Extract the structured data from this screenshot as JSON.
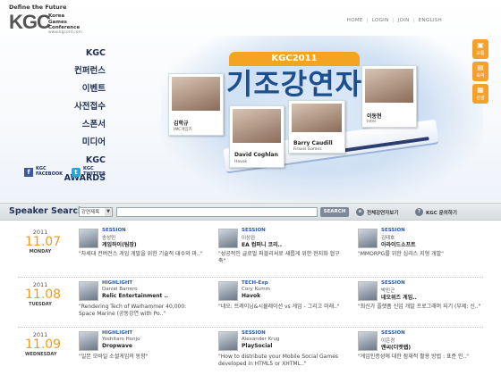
{
  "brand": {
    "tagline": "Define the Future",
    "logo_text": "KGC",
    "logo_lines": [
      "Korea",
      "Games",
      "Conference"
    ],
    "logo_url": "www.kgconf.com"
  },
  "topnav": [
    "HOME",
    "LOGIN",
    "JOIN",
    "ENGLISH"
  ],
  "menu": [
    "KGC",
    "컨퍼런스",
    "이벤트",
    "사전접수",
    "스폰서",
    "미디어",
    "KGC AWARDS"
  ],
  "social": [
    {
      "icon": "facebook-icon",
      "line1": "KGC",
      "line2": "FACEBOOK"
    },
    {
      "icon": "twitter-icon",
      "line1": "KGC",
      "line2": "TWITTER"
    }
  ],
  "quick": [
    {
      "icon": "car-icon",
      "label": "교통"
    },
    {
      "icon": "bed-icon",
      "label": "숙박"
    },
    {
      "icon": "map-icon",
      "label": "관광"
    }
  ],
  "banner": {
    "tab": "KGC2011",
    "title": "기조강연자"
  },
  "keynote": [
    {
      "name": "김학규",
      "org": "IMC게임즈"
    },
    {
      "name": "David Coghlan",
      "org": "Havok"
    },
    {
      "name": "Barry Caudill",
      "org": "Firaxis Games"
    },
    {
      "name": "이동현",
      "org": "Intel"
    }
  ],
  "search": {
    "title": "Speaker Search",
    "select_value": "강연제목",
    "input_value": "",
    "button": "SEARCH",
    "link1": "전체강연자보기",
    "link2": "KGC 문의하기"
  },
  "days": [
    {
      "year": "2011",
      "date": "11.07",
      "weekday": "MONDAY",
      "sessions": [
        {
          "tag": "SESSION",
          "speaker": "송성민",
          "company": "게임하이(팀장)",
          "title": "\"차세대 컨버전스 게임 개발을 위한 기술적 대수와 마..\""
        },
        {
          "tag": "SESSION",
          "speaker": "이상완",
          "company": "EA 컴퍼니 코리..",
          "title": "\"성공적인 글로벌 퍼블리셔로 새롭게 위한 현지화 협구축\""
        },
        {
          "tag": "SESSION",
          "speaker": "김태호",
          "company": "아라이드소프트",
          "title": "\"MMORPG를 위한 심리스 지형 개발\""
        }
      ]
    },
    {
      "year": "2011",
      "date": "11.08",
      "weekday": "TUESDAY",
      "sessions": [
        {
          "tag": "HIGHLIGHT",
          "speaker": "Daniel Barrero",
          "company": "Relic Entertainment ..",
          "title": "\"Rendering Tech of Warhammer 40,000: Space Marine (공동강연 with Po..\""
        },
        {
          "tag": "TECH-Exp",
          "speaker": "Cory Kumm",
          "company": "Havok",
          "title": "\"네오: 트레이닝&시뮬레이션 vs 게임 - 그리고 미래..\""
        },
        {
          "tag": "SESSION",
          "speaker": "박민근",
          "company": "네오위즈 게임..",
          "title": "\"최신가 플랫폼 신입 개발 프로그래머 되기 (부제: 신..\""
        }
      ]
    },
    {
      "year": "2011",
      "date": "11.09",
      "weekday": "WEDNESDAY",
      "sessions": [
        {
          "tag": "HIGHLIGHT",
          "speaker": "Yoshitaro Honjo",
          "company": "Dropwave",
          "title": "\"일본 모바일 소셜게임의 동향\""
        },
        {
          "tag": "SESSION",
          "speaker": "Alexander Krug",
          "company": "PlaySocial",
          "title": "\"How to distribute your Mobile Social Games developed in HTML5 or XHTML..\""
        },
        {
          "tag": "SESSION",
          "speaker": "이은경",
          "company": "엔씨(더맷랩)",
          "title": "\"게임인증성에 대한 잠재적 활용 방법 : 표준 인..\""
        }
      ]
    }
  ]
}
